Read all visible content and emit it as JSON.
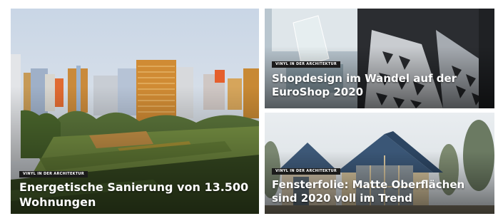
{
  "articles": [
    {
      "category": "VINYL IN DER ARCHITEKTUR",
      "title": "Energetische Sanierung von 13.500 Wohnungen"
    },
    {
      "category": "VINYL IN DER ARCHITEKTUR",
      "title": "Shopdesign im Wandel auf der EuroShop 2020"
    },
    {
      "category": "VINYL IN DER ARCHITEKTUR",
      "title": "Fensterfolie: Matte Oberflächen sind 2020 voll im Trend"
    }
  ]
}
